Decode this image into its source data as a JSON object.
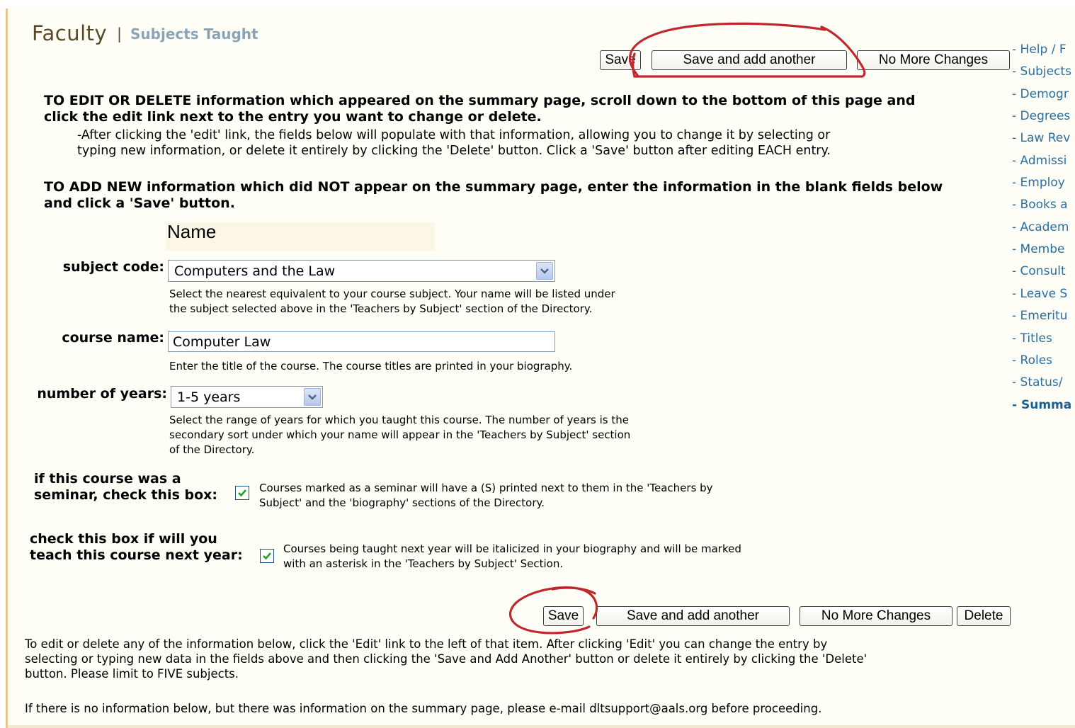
{
  "header": {
    "title": "Faculty",
    "separator": "|",
    "subtitle": "Subjects Taught"
  },
  "top_buttons": {
    "save": "Save",
    "save_add": "Save and add another",
    "no_more": "No More Changes"
  },
  "instructions": {
    "edit_heading_1": "TO EDIT OR DELETE information which appeared on the summary page, scroll down to the bottom of this page and",
    "edit_heading_2": "click the edit link next to the entry you want to change or delete.",
    "edit_detail_1": "-After clicking the 'edit' link, the fields below will populate with that information, allowing you to change it by selecting or",
    "edit_detail_2": "typing new information, or delete it entirely by clicking the 'Delete' button. Click a 'Save' button after editing EACH entry.",
    "add_heading_1": "TO ADD NEW information which did NOT appear on the summary page, enter the information in the blank fields below",
    "add_heading_2": "and click a 'Save' button."
  },
  "form": {
    "name_label": "Name",
    "subject_code": {
      "label": "subject code:",
      "value": "Computers and the Law",
      "help_1": "Select the nearest equivalent to your course subject. Your name will be listed under",
      "help_2": "the subject selected above in the 'Teachers by Subject' section of the Directory."
    },
    "course_name": {
      "label": "course name:",
      "value": "Computer Law",
      "help": "Enter the title of the course. The course titles are printed in your biography."
    },
    "years": {
      "label": "number of years:",
      "value": "1-5 years",
      "help_1": "Select the range of years for which you taught this course. The number of years is the",
      "help_2": "secondary sort under which your name will appear in the 'Teachers by Subject' section",
      "help_3": "of the Directory."
    },
    "seminar": {
      "label_1": "if this course was a",
      "label_2": "seminar, check this box:",
      "checked": true,
      "help_1": "Courses marked as a seminar will have a (S) printed next to them in the 'Teachers by",
      "help_2": "Subject' and the 'biography' sections of the Directory."
    },
    "next_year": {
      "label_1": "check this box if will you",
      "label_2": "teach this course next year:",
      "checked": true,
      "help_1": "Courses being taught next year will be italicized in your biography and will be marked",
      "help_2": "with an asterisk in the 'Teachers by Subject' Section."
    }
  },
  "bottom_buttons": {
    "save": "Save",
    "save_add": "Save and add another",
    "no_more": "No More Changes",
    "delete": "Delete"
  },
  "footer": {
    "line_1": "To edit or delete any of the information below, click the 'Edit' link to the left of that item. After clicking 'Edit' you can change the entry by",
    "line_2": "selecting or typing new data in the fields above and then clicking the 'Save and Add Another' button or delete it entirely by clicking the 'Delete'",
    "line_3": "button. Please limit to FIVE subjects.",
    "line_4": "If there is no information below, but there was information on the summary page, please e-mail dltsupport@aals.org before proceeding."
  },
  "sidebar": {
    "items": [
      "- Help / F",
      "- Subjects",
      "- Demogr",
      "- Degrees",
      "- Law Rev",
      "- Admissi",
      "- Employ",
      "- Books a",
      "- Academ",
      "- Membe",
      "- Consult",
      "- Leave S",
      "- Emeritu",
      "- Titles",
      "- Roles",
      "- Status/",
      "- Summa"
    ]
  },
  "colors": {
    "panel_bg": "#fefef6",
    "left_rule": "#e8c88a",
    "title_color": "#5a4a28",
    "subtitle_color": "#8aa3b5",
    "link_color": "#2a6ea0",
    "annotation_red": "#c0282e"
  }
}
